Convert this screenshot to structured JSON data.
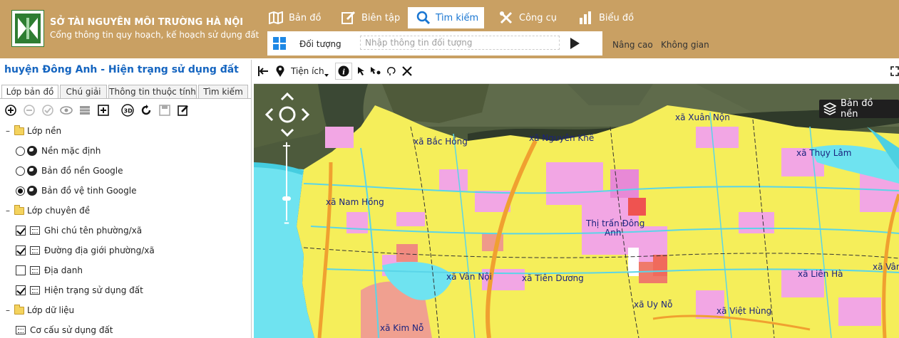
{
  "header": {
    "org_title": "SỞ TÀI NGUYÊN MÔI TRƯỜNG HÀ NỘI",
    "org_subtitle": "Cổng thông tin quy hoạch, kế hoạch sử dụng đất",
    "nav": [
      {
        "label": "Bản đồ",
        "icon": "map-icon"
      },
      {
        "label": "Biên tập",
        "icon": "edit-icon"
      },
      {
        "label": "Tìm kiếm",
        "icon": "search-icon",
        "active": true
      },
      {
        "label": "Công cụ",
        "icon": "tools-icon"
      },
      {
        "label": "Biểu đồ",
        "icon": "bar-chart-icon"
      }
    ],
    "search": {
      "label": "Đối tượng",
      "placeholder": "Nhập thông tin đối tượng"
    },
    "advanced_label": "Nâng cao",
    "spatial_label": "Không gian"
  },
  "panel": {
    "title": "huyện Đông Anh - Hiện trạng sử dụng đất",
    "tabs": [
      "Lớp bản đồ",
      "Chú giải",
      "Thông tin thuộc tính",
      "Tìm kiếm"
    ],
    "tree": {
      "base_group": "Lớp nền",
      "base_items": [
        "Nền mặc định",
        "Bản đồ nền Google",
        "Bản đồ vệ tinh Google"
      ],
      "thematic_group": "Lớp chuyên đề",
      "thematic_items": [
        "Ghi chú tên phường/xã",
        "Đường địa giới phường/xã",
        "Địa danh",
        "Hiện trạng sử dụng đất"
      ],
      "data_group": "Lớp dữ liệu",
      "data_items": [
        "Cơ cấu sử dụng đất"
      ]
    }
  },
  "map_toolbar": {
    "utility_label": "Tiện ích"
  },
  "map": {
    "basemap_label": "Bản đồ nền",
    "places": [
      "xã Xuân Nộn",
      "xã Bắc Hồng",
      "xã Nguyên Khê",
      "xã Thụy Lâm",
      "xã Nam Hồng",
      "Thị trấn Đông",
      "Anh",
      "xã Vân Nội",
      "xã Tiên Dương",
      "xã Liên Hà",
      "xã Vân",
      "xã Uy Nỗ",
      "xã Việt Hùng",
      "xã Kim Nỗ"
    ]
  },
  "colors": {
    "header_bg": "#c9a063",
    "active_tab_text": "#1976d2",
    "panel_title": "#1565c0",
    "land_yellow": "#f5ee5a",
    "residential_pink": "#f2a6e4",
    "water_cyan": "#6fe3f0",
    "road_orange": "#f0a030"
  }
}
